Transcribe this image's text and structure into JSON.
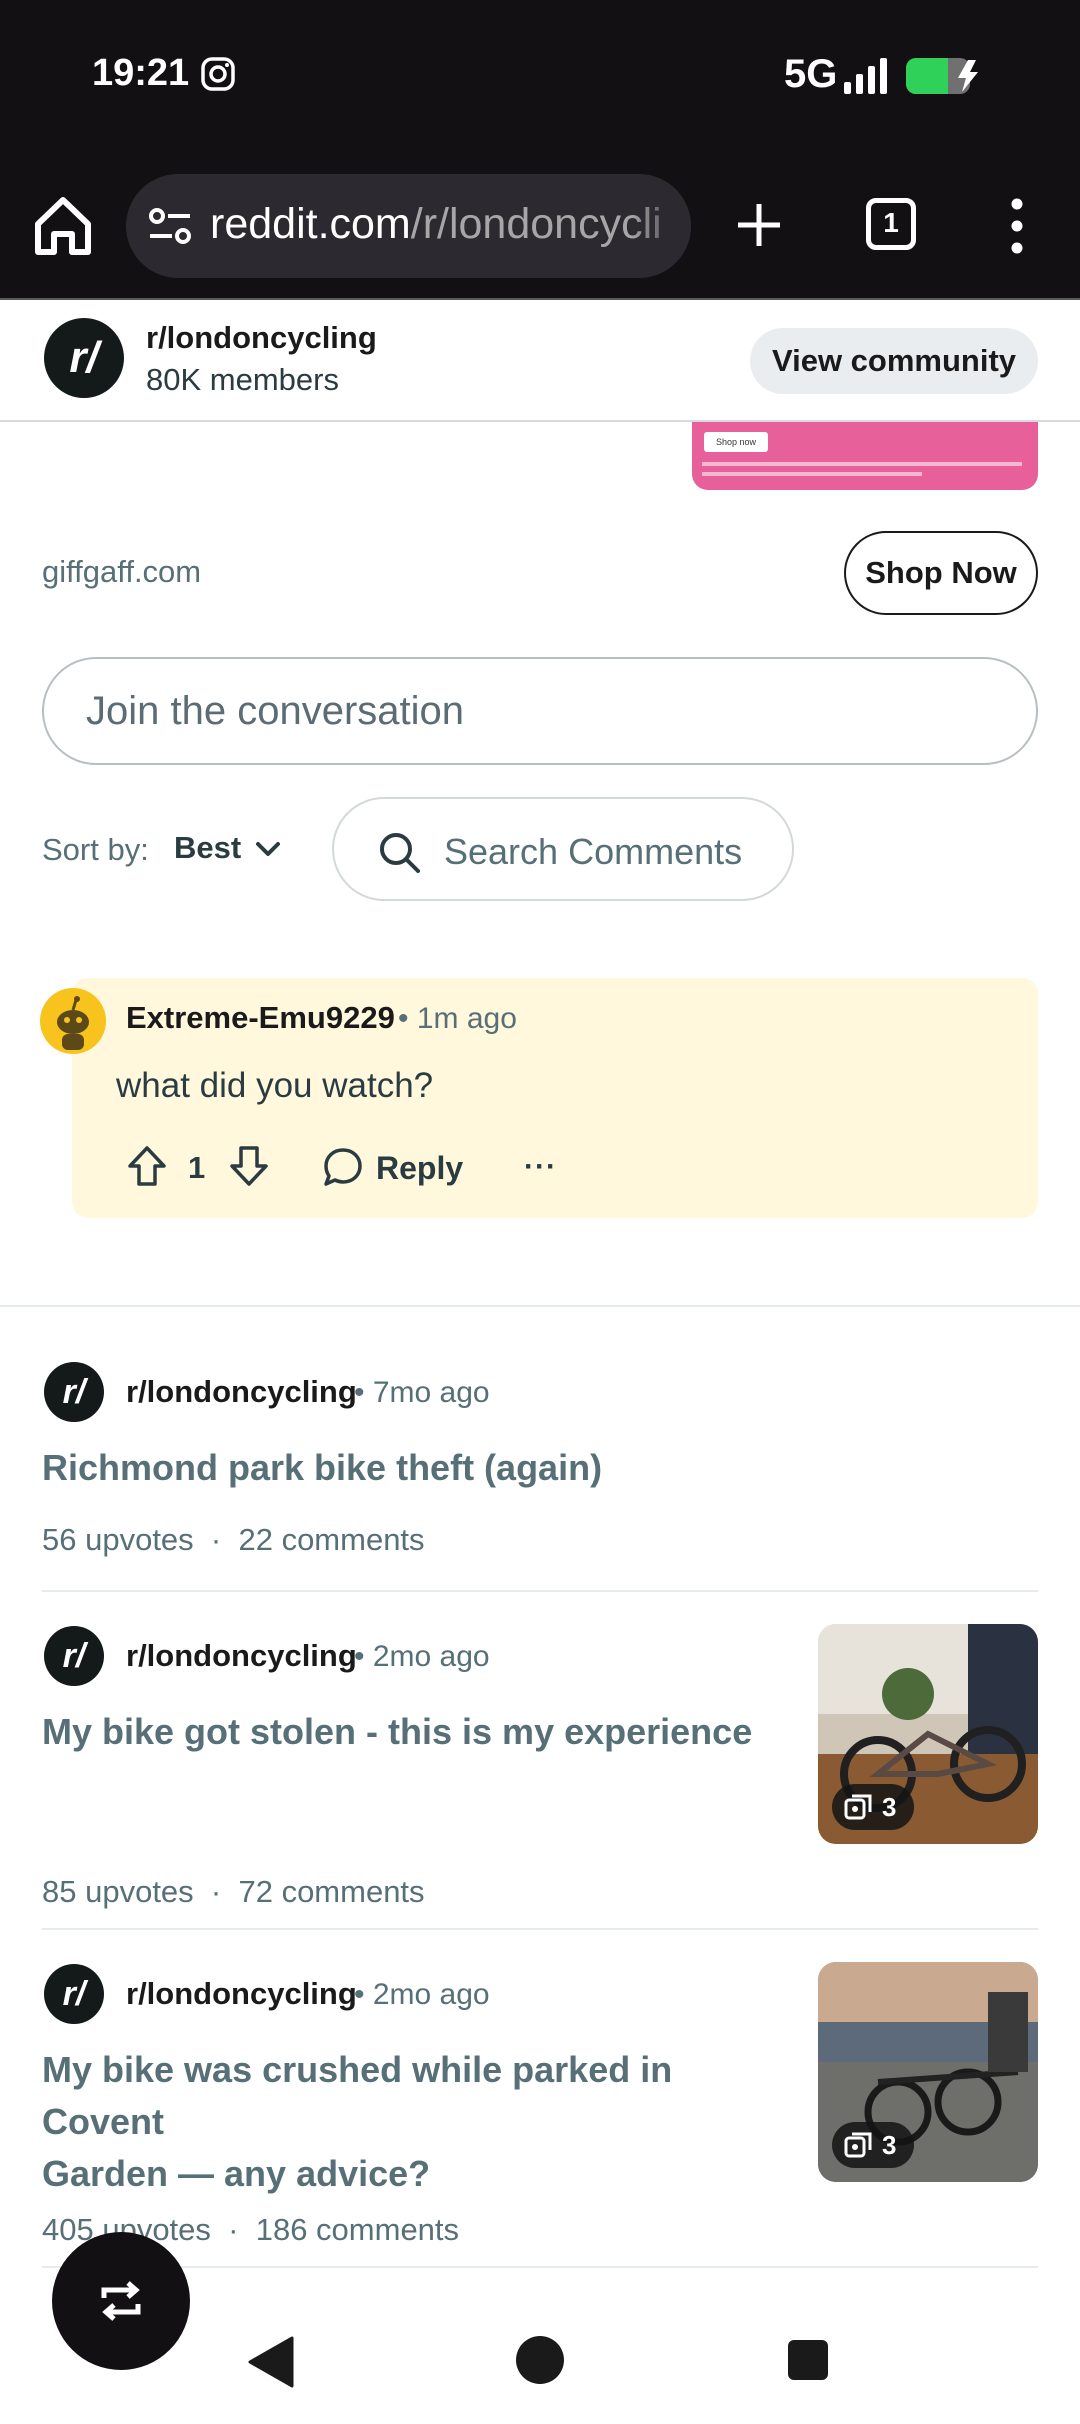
{
  "status_bar": {
    "time": "19:21",
    "network": "5G"
  },
  "browser": {
    "url_host": "reddit.com",
    "url_path": "/r/londoncycli",
    "tab_count": "1"
  },
  "community_bar": {
    "avatar": "r/",
    "name": "r/londoncycling",
    "members": "80K members",
    "view_button": "View community"
  },
  "ad": {
    "mini_button": "Shop now",
    "domain": "giffgaff.com",
    "cta": "Shop Now"
  },
  "join": {
    "placeholder": "Join the conversation"
  },
  "sort": {
    "label": "Sort by:",
    "value": "Best",
    "search_placeholder": "Search Comments"
  },
  "comment": {
    "author": "Extreme-Emu9229",
    "time": "• 1m ago",
    "body": "what did you watch?",
    "votes": "1",
    "reply": "Reply",
    "more": "···"
  },
  "related_posts": [
    {
      "avatar": "r/",
      "subreddit": "r/londoncycling",
      "time": "• 7mo ago",
      "title_lines": [
        "Richmond park bike theft (again)"
      ],
      "upvotes": "56 upvotes",
      "comments": "22 comments"
    },
    {
      "avatar": "r/",
      "subreddit": "r/londoncycling",
      "time": "• 2mo ago",
      "title_lines": [
        "My bike got stolen - this is my experience"
      ],
      "upvotes": "85 upvotes",
      "comments": "72 comments",
      "image_count": "3"
    },
    {
      "avatar": "r/",
      "subreddit": "r/londoncycling",
      "time": "• 2mo ago",
      "title_lines": [
        "My bike was crushed while parked in Covent",
        "Garden — any advice?"
      ],
      "upvotes": "405 upvotes",
      "comments": "186 comments",
      "image_count": "3"
    }
  ],
  "stat_separator": "·",
  "colors": {
    "brand_dark": "#141a19",
    "comment_highlight": "#fff8dc",
    "ad_pink": "#e8609a",
    "battery_green": "#2fd158"
  },
  "icons": [
    "instagram-icon",
    "signal-icon",
    "battery-charging-icon",
    "home-icon",
    "tune-icon",
    "plus-icon",
    "kebab-menu-icon",
    "chevron-down-icon",
    "search-icon",
    "upvote-icon",
    "downvote-icon",
    "reply-icon",
    "gallery-icon",
    "repost-icon"
  ]
}
